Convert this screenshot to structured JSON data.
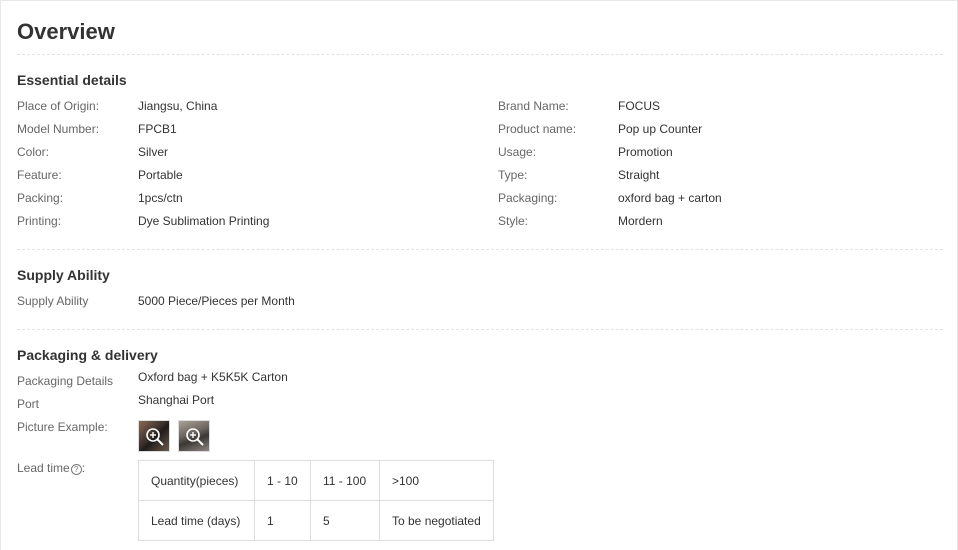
{
  "title": "Overview",
  "essential": {
    "heading": "Essential details",
    "left": [
      {
        "label": "Place of Origin:",
        "value": "Jiangsu, China"
      },
      {
        "label": "Model Number:",
        "value": "FPCB1"
      },
      {
        "label": "Color:",
        "value": "Silver"
      },
      {
        "label": "Feature:",
        "value": "Portable"
      },
      {
        "label": "Packing:",
        "value": "1pcs/ctn"
      },
      {
        "label": "Printing:",
        "value": "Dye Sublimation Printing"
      }
    ],
    "right": [
      {
        "label": "Brand Name:",
        "value": "FOCUS"
      },
      {
        "label": "Product name:",
        "value": "Pop up Counter"
      },
      {
        "label": "Usage:",
        "value": "Promotion"
      },
      {
        "label": "Type:",
        "value": "Straight"
      },
      {
        "label": "Packaging:",
        "value": "oxford bag + carton"
      },
      {
        "label": "Style:",
        "value": "Mordern"
      }
    ]
  },
  "supply": {
    "heading": "Supply Ability",
    "label": "Supply Ability",
    "value": "5000 Piece/Pieces per Month"
  },
  "packaging": {
    "heading": "Packaging & delivery",
    "details_label": "Packaging Details",
    "details_value": "Oxford bag + K5K5K Carton",
    "port_label": "Port",
    "port_value": "Shanghai Port",
    "picture_label": "Picture Example:",
    "lead_label": "Lead time",
    "help_glyph": "?",
    "lead_table": {
      "headers": [
        "Quantity(pieces)",
        "1 - 10",
        "11 - 100",
        ">100"
      ],
      "row": [
        "Lead time (days)",
        "1",
        "5",
        "To be negotiated"
      ]
    }
  },
  "icons": [
    "zoom-in-icon",
    "help-icon"
  ]
}
